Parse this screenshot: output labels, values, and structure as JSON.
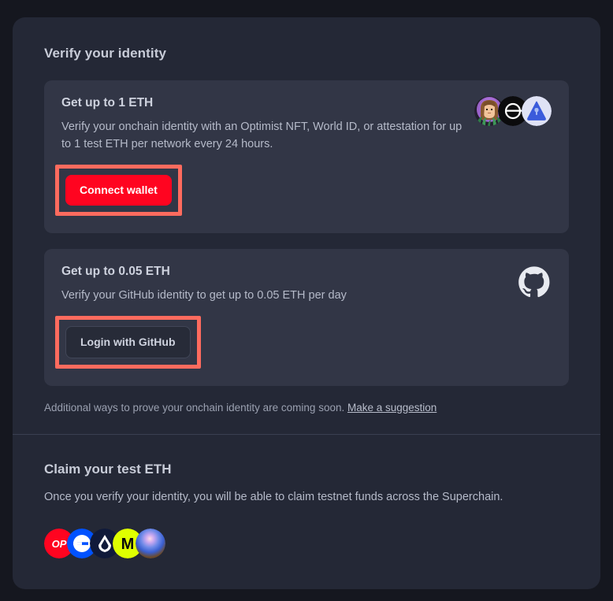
{
  "theme": {
    "page_bg": "#15171f",
    "panel_bg": "#242836",
    "card_bg": "#323646",
    "divider": "#3a3f51",
    "accent_red": "#ff0420",
    "annotation_red": "#ff6b5e",
    "heading_color": "#c8ccd8",
    "body_color": "#b5bac9"
  },
  "verify_section": {
    "title": "Verify your identity",
    "options": [
      {
        "title": "Get up to 1 ETH",
        "description": "Verify your onchain identity with an Optimist NFT, World ID, or attestation for up to 1 test ETH per network every 24 hours.",
        "button_label": "Connect wallet",
        "button_style": "primary",
        "highlighted": true,
        "icons": [
          {
            "name": "optimist-nft-icon",
            "label": "Optimist NFT"
          },
          {
            "name": "world-id-icon",
            "label": "World ID"
          },
          {
            "name": "eas-attestation-icon",
            "label": "EAS Attestation"
          }
        ]
      },
      {
        "title": "Get up to 0.05 ETH",
        "description": "Verify your GitHub identity to get up to 0.05 ETH per day",
        "button_label": "Login with GitHub",
        "button_style": "secondary",
        "highlighted": true,
        "icons": [
          {
            "name": "github-icon",
            "label": "GitHub"
          }
        ]
      }
    ],
    "footnote_text": "Additional ways to prove your onchain identity are coming soon.",
    "footnote_link": "Make a suggestion"
  },
  "claim_section": {
    "title": "Claim your test ETH",
    "description": "Once you verify your identity, you will be able to claim testnet funds across the Superchain.",
    "chains": [
      {
        "name": "optimism-chain-icon",
        "label": "OP",
        "color": "#ff0420"
      },
      {
        "name": "base-chain-icon",
        "label": "Base",
        "color": "#0052ff"
      },
      {
        "name": "lisk-chain-icon",
        "label": "Lisk",
        "color": "#101a3a"
      },
      {
        "name": "mode-chain-icon",
        "label": "Mode",
        "color": "#dfff00"
      },
      {
        "name": "zora-chain-icon",
        "label": "Zora",
        "color": "#4f6fe0"
      }
    ]
  }
}
